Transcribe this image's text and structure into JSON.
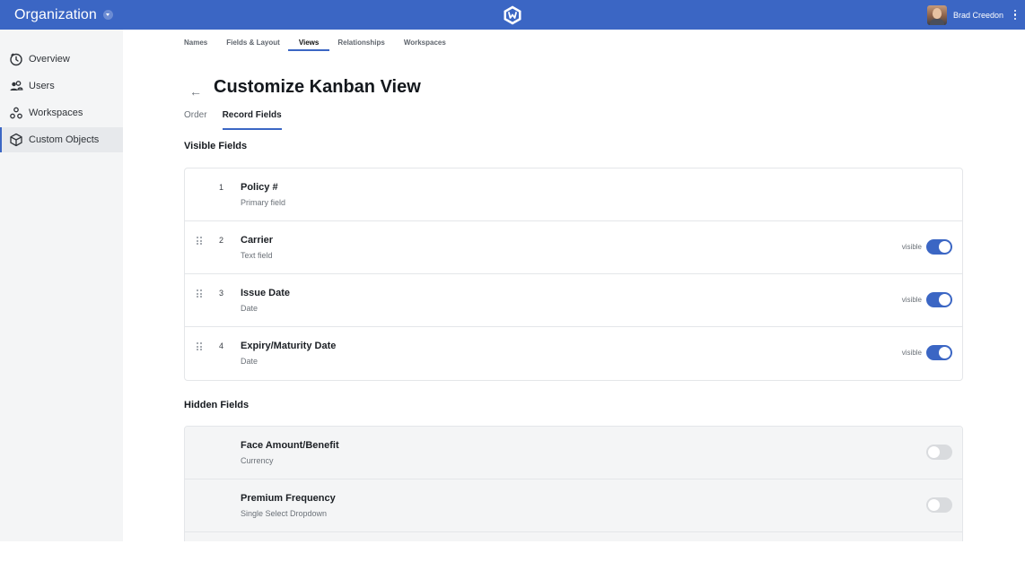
{
  "topbar": {
    "org_title": "Organization",
    "user_name": "Brad Creedon",
    "icons": [
      "chevron-down-icon",
      "app-logo-icon",
      "avatar",
      "more-vertical-icon"
    ]
  },
  "sidebar": {
    "items": [
      {
        "label": "Overview",
        "icon": "clock-icon",
        "active": false
      },
      {
        "label": "Users",
        "icon": "users-icon",
        "active": false
      },
      {
        "label": "Workspaces",
        "icon": "workspaces-icon",
        "active": false
      },
      {
        "label": "Custom Objects",
        "icon": "cube-icon",
        "active": true
      }
    ]
  },
  "main": {
    "tabs": [
      {
        "label": "Names",
        "active": false
      },
      {
        "label": "Fields & Layout",
        "active": false
      },
      {
        "label": "Views",
        "active": true
      },
      {
        "label": "Relationships",
        "active": false
      },
      {
        "label": "Workspaces",
        "active": false
      }
    ],
    "page_title": "Customize Kanban View",
    "back_icon": "arrow-left-icon",
    "subtabs": [
      {
        "label": "Order",
        "active": false
      },
      {
        "label": "Record Fields",
        "active": true
      }
    ],
    "visible_section_title": "Visible Fields",
    "visible_fields": [
      {
        "index": "1",
        "name": "Policy #",
        "type": "Primary field",
        "draggable": false,
        "toggle_label": "",
        "on": true
      },
      {
        "index": "2",
        "name": "Carrier",
        "type": "Text field",
        "draggable": true,
        "toggle_label": "visible",
        "on": true
      },
      {
        "index": "3",
        "name": "Issue Date",
        "type": "Date",
        "draggable": true,
        "toggle_label": "visible",
        "on": true
      },
      {
        "index": "4",
        "name": "Expiry/Maturity Date",
        "type": "Date",
        "draggable": true,
        "toggle_label": "visible",
        "on": true
      }
    ],
    "hidden_section_title": "Hidden Fields",
    "hidden_fields": [
      {
        "name": "Face Amount/Benefit",
        "type": "Currency",
        "on": false
      },
      {
        "name": "Premium Frequency",
        "type": "Single Select Dropdown",
        "on": false
      }
    ]
  },
  "colors": {
    "accent": "#3b66c4",
    "sidebar_bg": "#f4f5f6",
    "toggle_off": "#d9dbde"
  }
}
